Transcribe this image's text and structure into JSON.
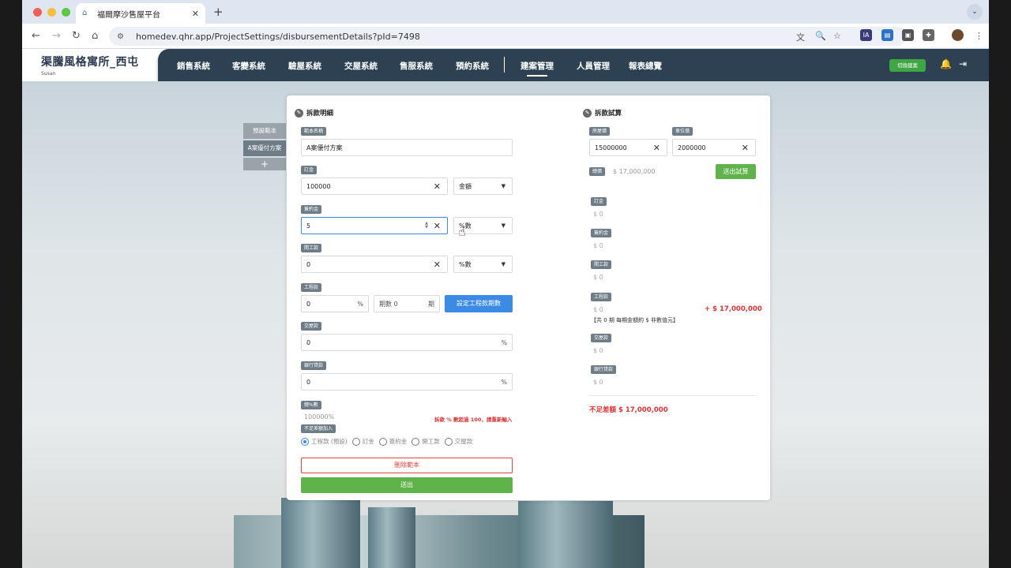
{
  "browser": {
    "tab_title": "福爾摩沙售屋平台",
    "url": "homedev.qhr.app/ProjectSettings/disbursementDetails?pId=7498"
  },
  "app": {
    "brand_title": "渠騰風格寓所_西屯",
    "user": "Susan",
    "menu": [
      "銷售系統",
      "客變系統",
      "驗屋系統",
      "交屋系統",
      "售服系統",
      "預約系統",
      "建案管理",
      "人員管理",
      "報表總覽"
    ],
    "active_menu": "建案管理",
    "switch_button": "切換建案"
  },
  "templates": {
    "items": [
      "預設範本",
      "A案優付方案"
    ],
    "add": "+"
  },
  "detail": {
    "title": "拆款明細",
    "name_label": "範本名稱",
    "name_value": "A案優付方案",
    "deposit_label": "訂金",
    "deposit_value": "100000",
    "deposit_unit": "金額",
    "contract_label": "簽約金",
    "contract_value": "5",
    "contract_unit": "%數",
    "start_label": "開工款",
    "start_value": "0",
    "start_unit": "%數",
    "progress_label": "工程款",
    "progress_value": "0",
    "progress_pct": "%",
    "period_label": "期數",
    "period_value": "0",
    "period_suffix": "期",
    "set_period_button": "設定工程款期數",
    "handover_label": "交屋款",
    "handover_value": "0",
    "handover_pct": "%",
    "loan_label": "銀行貸款",
    "loan_value": "0",
    "loan_pct": "%",
    "total_label": "總%數",
    "total_value": "100000%",
    "total_warning": "拆款 % 數超過 100，請重新輸入",
    "shortfall_label": "不足差額加入",
    "radio_options": [
      "工程款 (預設)",
      "訂金",
      "簽約金",
      "開工款",
      "交屋款"
    ],
    "delete_button": "刪除範本",
    "submit_button": "送出"
  },
  "calc": {
    "title": "拆款試算",
    "house_label": "房屋價",
    "house_value": "15000000",
    "parking_label": "車位價",
    "parking_value": "2000000",
    "total_label": "總價",
    "total_value": "$ 17,000,000",
    "calc_button": "送出試算",
    "rows": [
      {
        "label": "訂金",
        "value": "$ 0"
      },
      {
        "label": "簽約金",
        "value": "$ 0"
      },
      {
        "label": "開工款",
        "value": "$ 0"
      },
      {
        "label": "工程款",
        "value": "$ 0"
      },
      {
        "label": "交屋款",
        "value": "$ 0"
      },
      {
        "label": "銀行貸款",
        "value": "$ 0"
      }
    ],
    "progress_extra": "+ $ 17,000,000",
    "progress_note": "【共 0 期 每期金額約 $ 非數值元】",
    "shortfall": "不足差額  $ 17,000,000"
  },
  "colors": {
    "menubar": "#2d4152",
    "tag": "#6d7c87",
    "primary": "#3b8ae6",
    "success": "#5fb34a",
    "danger": "#dd3333"
  }
}
